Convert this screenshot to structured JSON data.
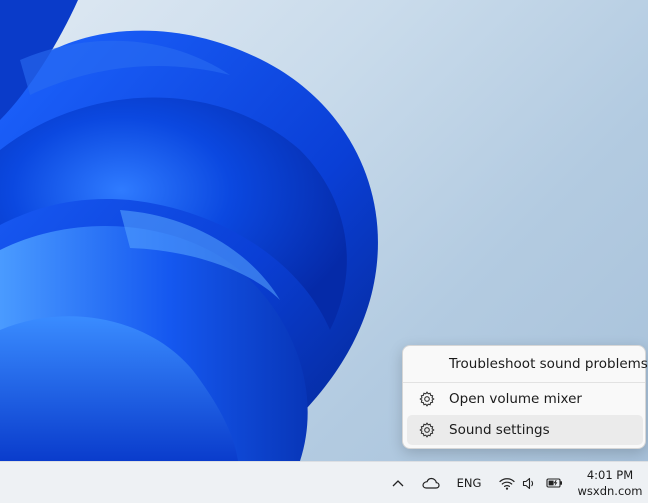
{
  "context_menu": {
    "items": [
      {
        "label": "Troubleshoot sound problems",
        "icon": "none"
      },
      {
        "label": "Open volume mixer",
        "icon": "gear-icon"
      },
      {
        "label": "Sound settings",
        "icon": "gear-icon",
        "highlighted": true
      }
    ]
  },
  "taskbar": {
    "tray_icons": [
      "chevron-up-icon",
      "onedrive-cloud-icon",
      "wifi-icon",
      "volume-icon",
      "battery-charging-icon"
    ],
    "language": "ENG",
    "clock": {
      "time": "4:01 PM",
      "date": "wsxdn.com"
    }
  },
  "colors": {
    "wallpaper_blue": "#0a3fd6",
    "wallpaper_bg": "#c9dbeb",
    "menu_bg": "#f9f9f9",
    "menu_highlight": "#ebebeb",
    "taskbar_bg": "#eef1f4"
  }
}
